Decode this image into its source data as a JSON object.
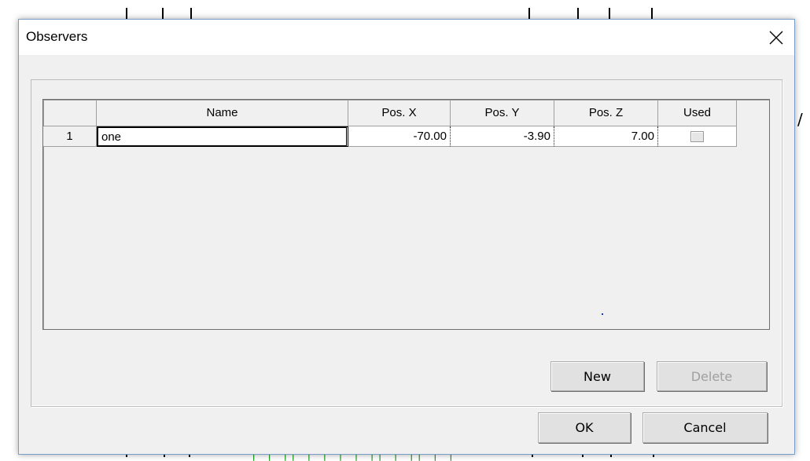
{
  "dialog": {
    "title": "Observers",
    "close_icon": "close-icon"
  },
  "grid": {
    "columns": [
      "Name",
      "Pos. X",
      "Pos. Y",
      "Pos. Z",
      "Used"
    ],
    "rows": [
      {
        "index": "1",
        "name": "one",
        "pos_x": "-70.00",
        "pos_y": "-3.90",
        "pos_z": "7.00",
        "used": false
      }
    ]
  },
  "buttons": {
    "new_label": "New",
    "delete_label": "Delete",
    "ok_label": "OK",
    "cancel_label": "Cancel"
  }
}
